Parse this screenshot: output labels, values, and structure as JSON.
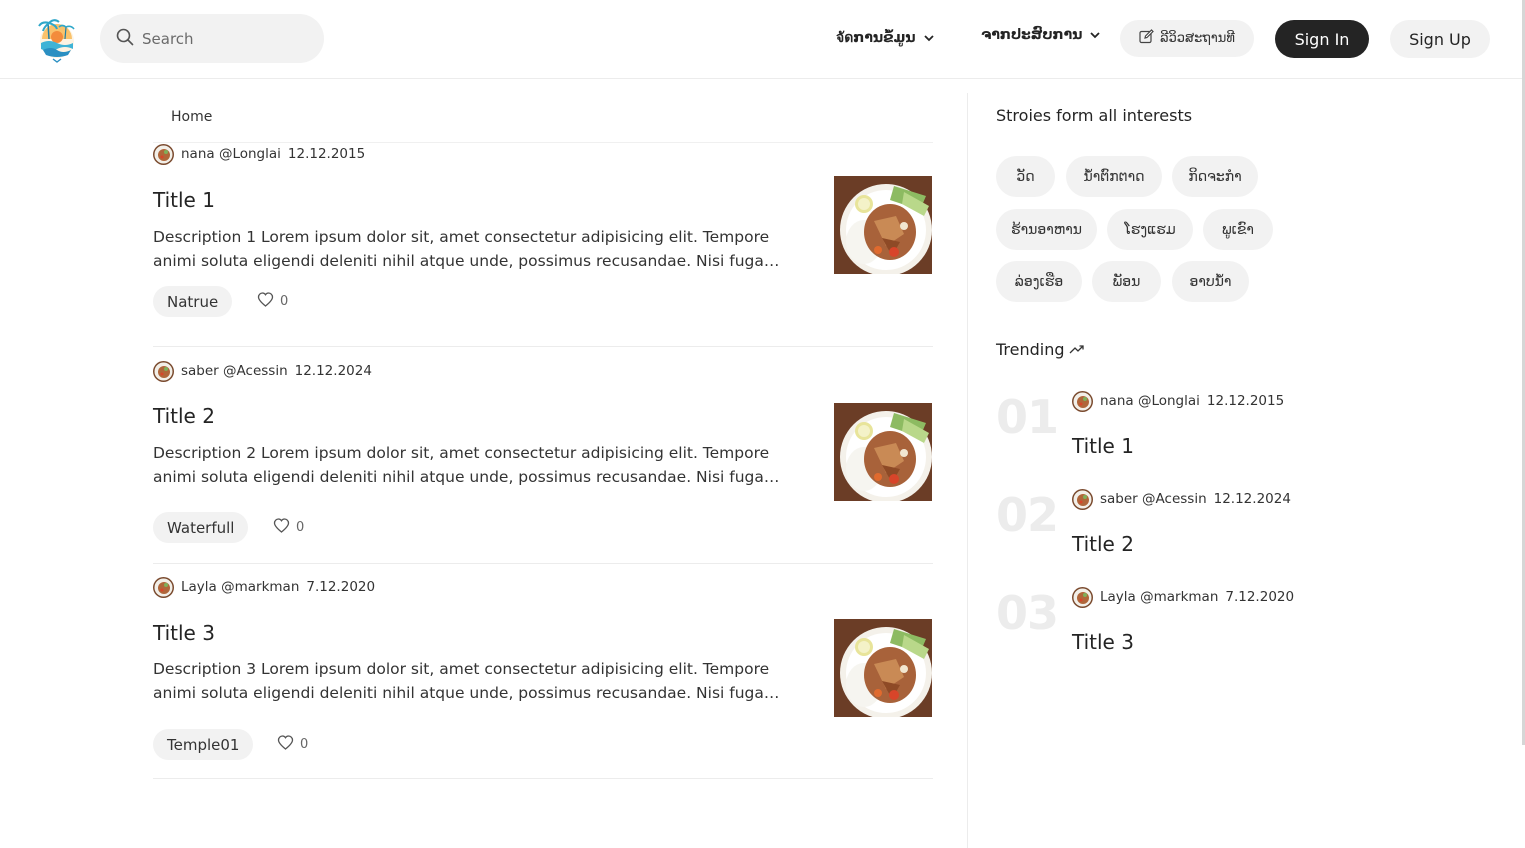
{
  "header": {
    "search_placeholder": "Search",
    "menu1_label": "จัดການຂໍ້ມູນ",
    "menu2_label": "ຈາກປະສົບການ",
    "review_label": "ລີວິວສະຖານທີ",
    "signin_label": "Sign In",
    "signup_label": "Sign Up"
  },
  "breadcrumb": "Home",
  "articles": [
    {
      "author": "nana @Longlai",
      "date": "12.12.2015",
      "title": "Title 1",
      "description": "Description 1 Lorem ipsum dolor sit, amet consectetur adipisicing elit. Tempore animi soluta eligendi deleniti nihil atque unde, possimus recusandae. Nisi fuga maiores alias vero?",
      "tag": "Natrue",
      "likes": "0"
    },
    {
      "author": "saber @Acessin",
      "date": "12.12.2024",
      "title": "Title 2",
      "description": "Description 2 Lorem ipsum dolor sit, amet consectetur adipisicing elit. Tempore animi soluta eligendi deleniti nihil atque unde, possimus recusandae. Nisi fuga maiores alias vero?",
      "tag": "Waterfull",
      "likes": "0"
    },
    {
      "author": "Layla @markman",
      "date": "7.12.2020",
      "title": "Title 3",
      "description": "Description 3 Lorem ipsum dolor sit, amet consectetur adipisicing elit. Tempore animi soluta eligendi deleniti nihil atque unde, possimus recusandae. Nisi fuga maiores alias vero?",
      "tag": "Temple01",
      "likes": "0"
    }
  ],
  "sidebar": {
    "topics_heading": "Stroies form all interests",
    "topics": [
      "ວັດ",
      "ນ້ຳຕົກຕາດ",
      "ກິດຈະກຳ",
      "ຮ້ານອາຫານ",
      "ໂຮງແຮມ",
      "ພູເຂົາ",
      "ລ່ອງເຮືອ",
      "ພັອນ",
      "ອາບນ້ຳ"
    ],
    "trending_heading": "Trending",
    "trending": [
      {
        "rank": "01",
        "author": "nana @Longlai",
        "date": "12.12.2015",
        "title": "Title 1"
      },
      {
        "rank": "02",
        "author": "saber @Acessin",
        "date": "12.12.2024",
        "title": "Title 2"
      },
      {
        "rank": "03",
        "author": "Layla @markman",
        "date": "7.12.2020",
        "title": "Title 3"
      }
    ]
  },
  "colors": {
    "primary_button": "#242424",
    "pill_bg": "#f2f2f2",
    "trend_number": "#ececec"
  }
}
